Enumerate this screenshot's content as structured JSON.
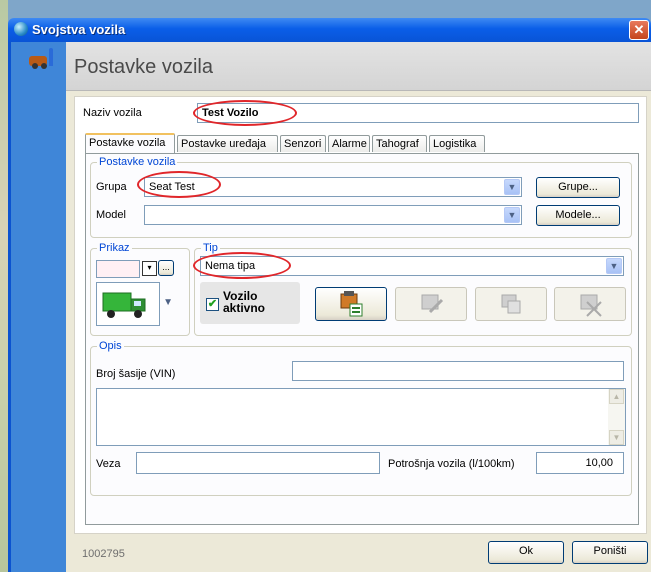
{
  "window": {
    "title": "Svojstva vozila",
    "close_glyph": "✕"
  },
  "header": {
    "title": "Postavke vozila"
  },
  "vehicle_name": {
    "label": "Naziv vozila",
    "value": "Test Vozilo"
  },
  "tabs": [
    {
      "label": "Postavke vozila",
      "active": true
    },
    {
      "label": "Postavke uređaja",
      "active": false
    },
    {
      "label": "Senzori",
      "active": false
    },
    {
      "label": "Alarme",
      "active": false
    },
    {
      "label": "Tahograf",
      "active": false
    },
    {
      "label": "Logistika",
      "active": false
    }
  ],
  "settings_group": {
    "legend": "Postavke vozila",
    "group_label": "Grupa",
    "group_value": "Seat Test",
    "groups_button": "Grupe...",
    "model_label": "Model",
    "model_value": "",
    "models_button": "Modele..."
  },
  "display_group": {
    "legend": "Prikaz",
    "color_button": "...",
    "vehicle_icon": "truck-icon"
  },
  "type_group": {
    "legend": "Tip",
    "type_value": "Nema tipa",
    "active_label_line1": "Vozilo",
    "active_label_line2": "aktivno",
    "active_checked": true
  },
  "description_group": {
    "legend": "Opis",
    "vin_label": "Broj šasije (VIN)",
    "vin_value": "",
    "notes_value": "",
    "link_label": "Veza",
    "link_value": "",
    "consumption_label": "Potrošnja vozila (l/100km)",
    "consumption_value": "10,00"
  },
  "footer": {
    "id": "1002795",
    "ok": "Ok",
    "cancel": "Poništi"
  },
  "colors": {
    "titlebar": "#0a5ee8",
    "highlight_oval": "#e0262a",
    "legend": "#0046d5"
  }
}
